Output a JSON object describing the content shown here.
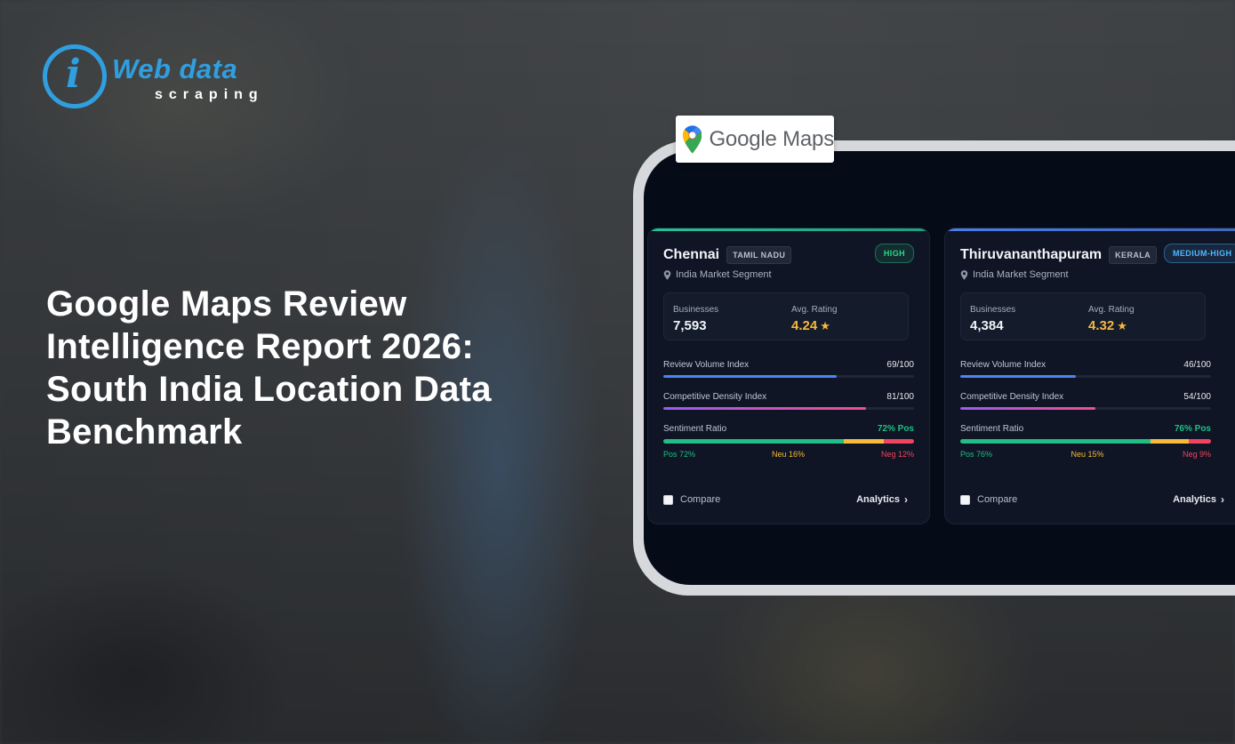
{
  "brand": {
    "logo_letter": "i",
    "word1": "Web data",
    "word2": "scraping",
    "color": "#2f9fe0"
  },
  "headline": "Google Maps Review Intelligence Report 2026: South India Location Data Benchmark",
  "badge": {
    "text": "Google Maps",
    "icon": "map-pin-icon"
  },
  "cards": [
    {
      "city": "Chennai",
      "state": "TAMIL NADU",
      "level": "HIGH",
      "level_color": "#2fd68b",
      "topbar_color": "#22c29a",
      "segment": "India Market Segment",
      "businesses_label": "Businesses",
      "businesses": "7,593",
      "rating_label": "Avg. Rating",
      "rating": "4.24",
      "star": "★",
      "review_label": "Review Volume Index",
      "review_value": "69/100",
      "review_pct": 69,
      "density_label": "Competitive Density Index",
      "density_value": "81/100",
      "density_pct": 81,
      "sentiment_label": "Sentiment Ratio",
      "sentiment_value": "72% Pos",
      "pos": 72,
      "neu": 16,
      "neg": 12,
      "pos_label": "Pos 72%",
      "neu_label": "Neu 16%",
      "neg_label": "Neg 12%",
      "compare_label": "Compare",
      "analytics_label": "Analytics",
      "chevron": "›"
    },
    {
      "city": "Thiruvananthapuram",
      "state": "KERALA",
      "level": "MEDIUM-HIGH",
      "level_color": "#4fb7ff",
      "topbar_color": "#4a7de8",
      "segment": "India Market Segment",
      "businesses_label": "Businesses",
      "businesses": "4,384",
      "rating_label": "Avg. Rating",
      "rating": "4.32",
      "star": "★",
      "review_label": "Review Volume Index",
      "review_value": "46/100",
      "review_pct": 46,
      "density_label": "Competitive Density Index",
      "density_value": "54/100",
      "density_pct": 54,
      "sentiment_label": "Sentiment Ratio",
      "sentiment_value": "76% Pos",
      "pos": 76,
      "neu": 15,
      "neg": 9,
      "pos_label": "Pos 76%",
      "neu_label": "Neu 15%",
      "neg_label": "Neg 9%",
      "compare_label": "Compare",
      "analytics_label": "Analytics",
      "chevron": "›"
    }
  ],
  "colors": {
    "positive": "#1fbf86",
    "neutral": "#f5b93b",
    "negative": "#f0445f",
    "review_bar": "#4a86f0",
    "density_bar_start": "#9b5cf0",
    "density_bar_end": "#f04f8f"
  }
}
